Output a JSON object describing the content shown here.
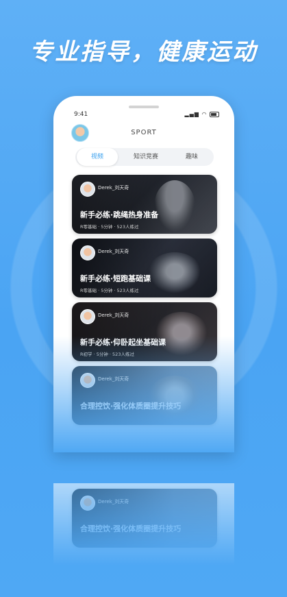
{
  "headline": "专业指导，健康运动",
  "status": {
    "time": "9:41",
    "signal": "▂▄▆",
    "wifi": "◠"
  },
  "app": {
    "title": "SPORT"
  },
  "tabs": [
    {
      "label": "视频",
      "active": true
    },
    {
      "label": "知识竞赛",
      "active": false
    },
    {
      "label": "趣味",
      "active": false
    }
  ],
  "cards": [
    {
      "author": "Derek_刘天奇",
      "title": "新手必练·跳绳热身准备",
      "meta": "R零基础 · 5分钟 · 523人练过"
    },
    {
      "author": "Derek_刘天奇",
      "title": "新手必练·短跑基础课",
      "meta": "R零基础 · 5分钟 · 523人练过"
    },
    {
      "author": "Derek_刘天奇",
      "title": "新手必练·仰卧起坐基础课",
      "meta": "R初学 · 5分钟 · 523人练过"
    },
    {
      "author": "Derek_刘天奇",
      "title": "合理控饮·强化体质圈提升技巧",
      "meta": ""
    }
  ],
  "colors": {
    "background": "#4fa8f4",
    "accent": "#3aa0ee"
  }
}
